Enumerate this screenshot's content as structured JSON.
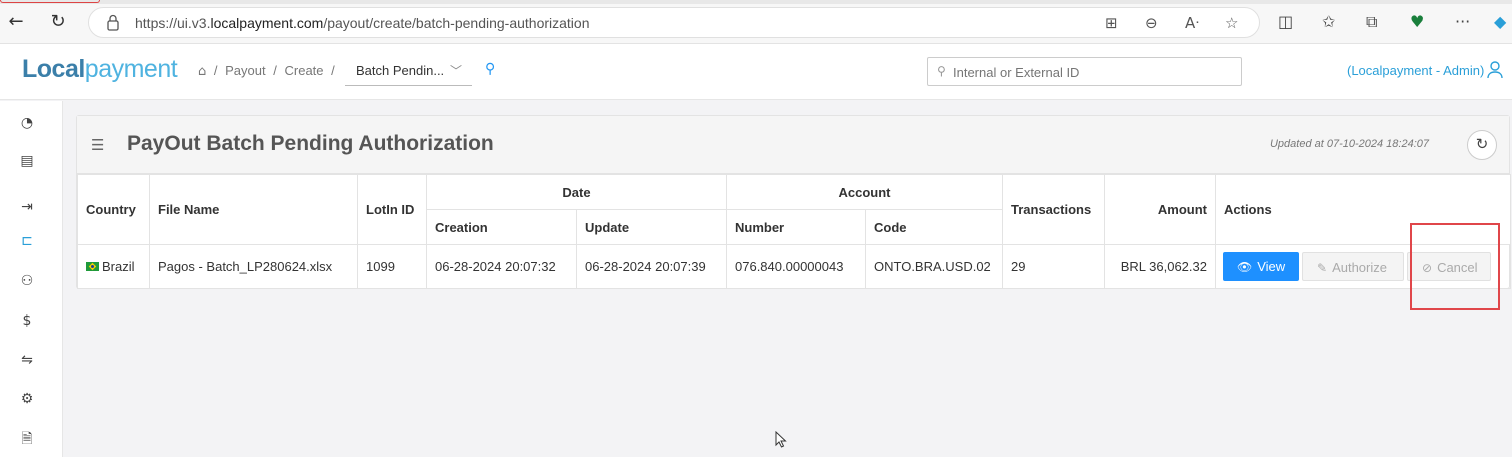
{
  "browser": {
    "url_prefix": "https://ui.v3.",
    "url_host": "localpayment.com",
    "url_path": "/payout/create/batch-pending-authorization"
  },
  "header": {
    "logo_bold": "Local",
    "logo_light": "payment",
    "crumbs": [
      "Payout",
      "Create"
    ],
    "current_crumb": "Batch Pendin...",
    "search_placeholder": "Internal or External ID",
    "user": "(Localpayment - Admin)"
  },
  "page": {
    "title": "PayOut Batch Pending Authorization",
    "updated": "Updated at 07-10-2024 18:24:07"
  },
  "table": {
    "headers": {
      "country": "Country",
      "file_name": "File Name",
      "lot_id": "LotIn ID",
      "date": "Date",
      "creation": "Creation",
      "update": "Update",
      "account": "Account",
      "number": "Number",
      "code": "Code",
      "transactions": "Transactions",
      "amount": "Amount",
      "actions": "Actions"
    },
    "row": {
      "country": "Brazil",
      "file_name": "Pagos - Batch_LP280624.xlsx",
      "lot_id": "1099",
      "creation": "06-28-2024 20:07:32",
      "update": "06-28-2024 20:07:39",
      "number": "076.840.00000043",
      "code": "ONTO.BRA.USD.02",
      "transactions": "29",
      "amount": "BRL 36,062.32"
    },
    "actions": {
      "view": "View",
      "authorize": "Authorize",
      "cancel": "Cancel"
    }
  },
  "colors": {
    "accent": "#1e90ff",
    "highlight": "#e0464a"
  }
}
